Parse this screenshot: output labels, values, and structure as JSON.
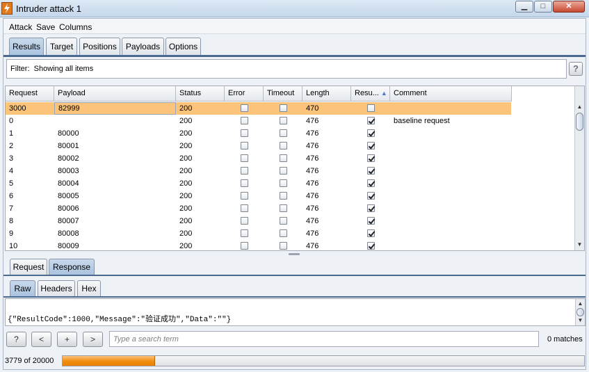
{
  "window": {
    "title": "Intruder attack 1",
    "min_glyph": "▁",
    "max_glyph": "□",
    "close_glyph": "✕"
  },
  "menu": [
    "Attack",
    "Save",
    "Columns"
  ],
  "tabs": [
    "Results",
    "Target",
    "Positions",
    "Payloads",
    "Options"
  ],
  "filter": {
    "label": "Filter:",
    "text": "Showing all items"
  },
  "help_label": "?",
  "table": {
    "columns": [
      "Request",
      "Payload",
      "Status",
      "Error",
      "Timeout",
      "Length",
      "Resu...",
      "Comment"
    ],
    "sort_arrow": "▲",
    "rows": [
      {
        "request": "3000",
        "payload": "82999",
        "status": "200",
        "error": false,
        "timeout": false,
        "length": "470",
        "result": false,
        "comment": "",
        "selected": true
      },
      {
        "request": "0",
        "payload": "",
        "status": "200",
        "error": false,
        "timeout": false,
        "length": "476",
        "result": true,
        "comment": "baseline request"
      },
      {
        "request": "1",
        "payload": "80000",
        "status": "200",
        "error": false,
        "timeout": false,
        "length": "476",
        "result": true,
        "comment": ""
      },
      {
        "request": "2",
        "payload": "80001",
        "status": "200",
        "error": false,
        "timeout": false,
        "length": "476",
        "result": true,
        "comment": ""
      },
      {
        "request": "3",
        "payload": "80002",
        "status": "200",
        "error": false,
        "timeout": false,
        "length": "476",
        "result": true,
        "comment": ""
      },
      {
        "request": "4",
        "payload": "80003",
        "status": "200",
        "error": false,
        "timeout": false,
        "length": "476",
        "result": true,
        "comment": ""
      },
      {
        "request": "5",
        "payload": "80004",
        "status": "200",
        "error": false,
        "timeout": false,
        "length": "476",
        "result": true,
        "comment": ""
      },
      {
        "request": "6",
        "payload": "80005",
        "status": "200",
        "error": false,
        "timeout": false,
        "length": "476",
        "result": true,
        "comment": ""
      },
      {
        "request": "7",
        "payload": "80006",
        "status": "200",
        "error": false,
        "timeout": false,
        "length": "476",
        "result": true,
        "comment": ""
      },
      {
        "request": "8",
        "payload": "80007",
        "status": "200",
        "error": false,
        "timeout": false,
        "length": "476",
        "result": true,
        "comment": ""
      },
      {
        "request": "9",
        "payload": "80008",
        "status": "200",
        "error": false,
        "timeout": false,
        "length": "476",
        "result": true,
        "comment": ""
      },
      {
        "request": "10",
        "payload": "80009",
        "status": "200",
        "error": false,
        "timeout": false,
        "length": "476",
        "result": true,
        "comment": ""
      }
    ]
  },
  "detail_tabs": [
    "Request",
    "Response"
  ],
  "view_tabs": [
    "Raw",
    "Headers",
    "Hex"
  ],
  "response_body": "{\"ResultCode\":1000,\"Message\":\"验证成功\",\"Data\":\"\"}",
  "search": {
    "help": "?",
    "prev": "<",
    "add": "+",
    "next": ">",
    "placeholder": "Type a search term",
    "matches": "0 matches"
  },
  "status": {
    "text": "3779 of 20000",
    "progress": 0.1775
  },
  "colors": {
    "selected_row": "#fcc37b",
    "progress": "#f08d0e",
    "tab_selected": "#b9cde4"
  }
}
